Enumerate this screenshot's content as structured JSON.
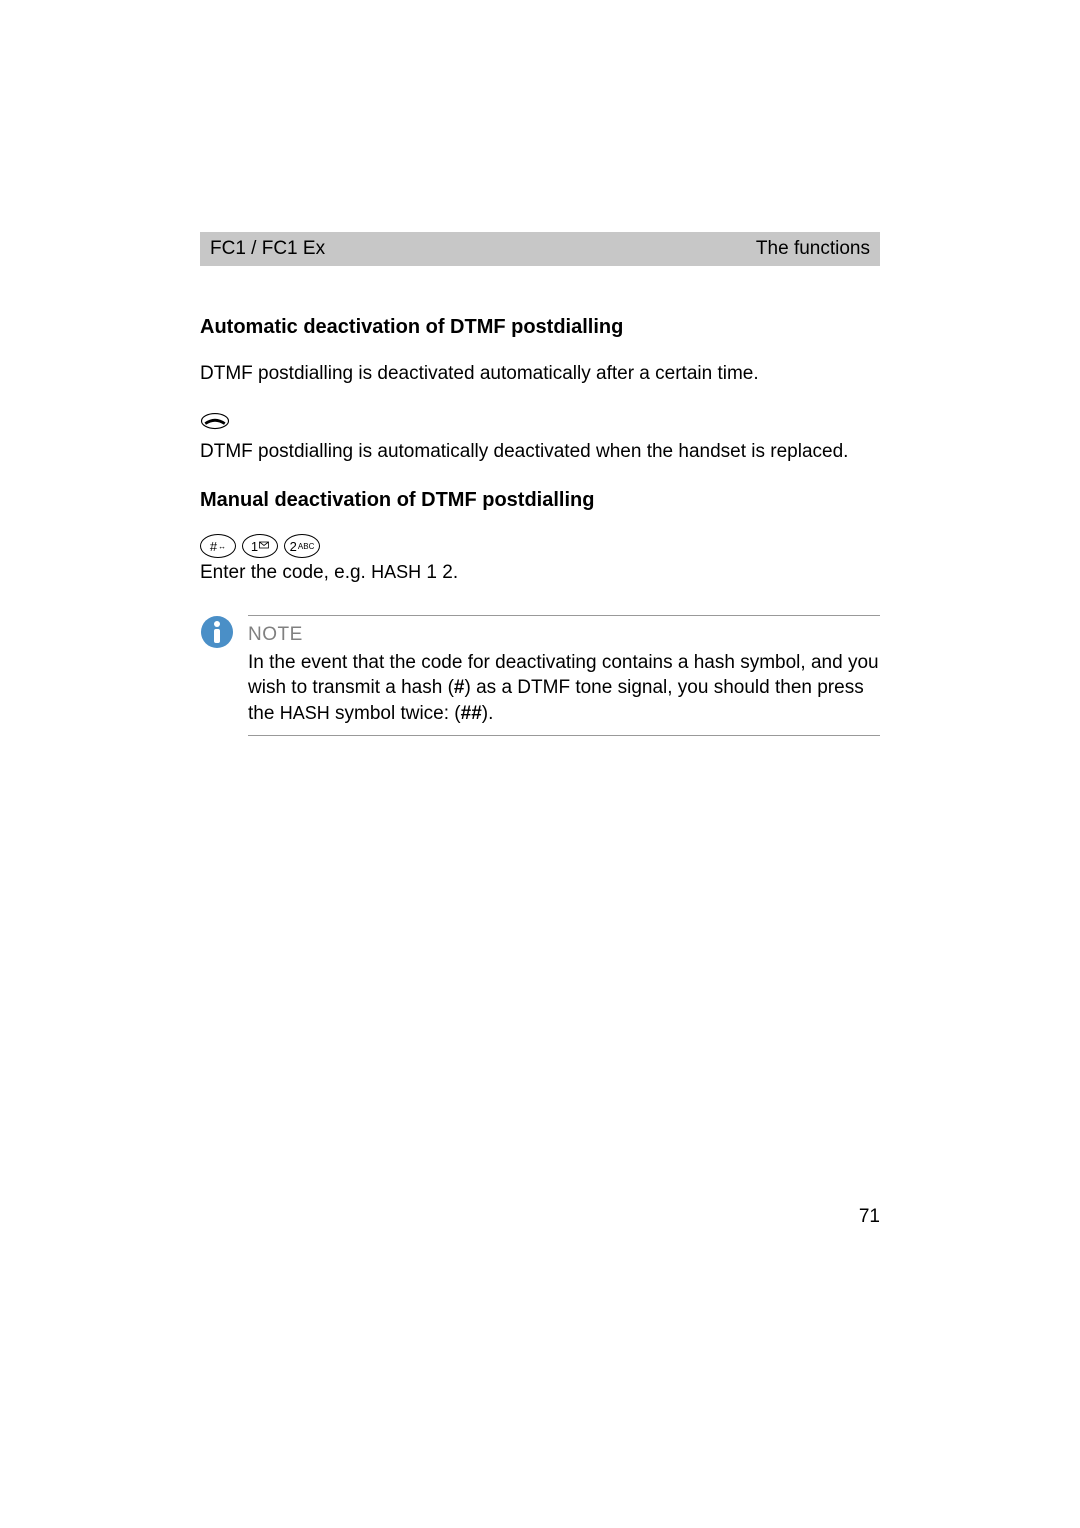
{
  "header": {
    "left": "FC1 / FC1 Ex",
    "right": "The functions"
  },
  "section1": {
    "heading": "Automatic deactivation of DTMF postdialling",
    "line1": "DTMF postdialling is deactivated automatically after a certain time.",
    "line2": "DTMF postdialling is automatically deactivated when the handset is replaced."
  },
  "section2": {
    "heading": "Manual deactivation of DTMF postdialling",
    "keys": {
      "hash": {
        "main": "#",
        "sub": "↔"
      },
      "one": {
        "main": "1",
        "sub": ""
      },
      "two": {
        "main": "2",
        "sub": "ABC"
      }
    },
    "enterCode": "Enter the code, e.g. ",
    "enterCodeHash": "HASH",
    "enterCodeTail": " 1 2."
  },
  "note": {
    "title": "NOTE",
    "part1": "In the event that the code for deactivating contains a hash symbol, and you wish to transmit a hash (",
    "bold1": "#",
    "part2": ") as a DTMF tone signal, you should then press the ",
    "smallcaps": "HASH",
    "part3": " symbol twice: (",
    "bold2": "##",
    "part4": ")."
  },
  "pageNumber": "71"
}
